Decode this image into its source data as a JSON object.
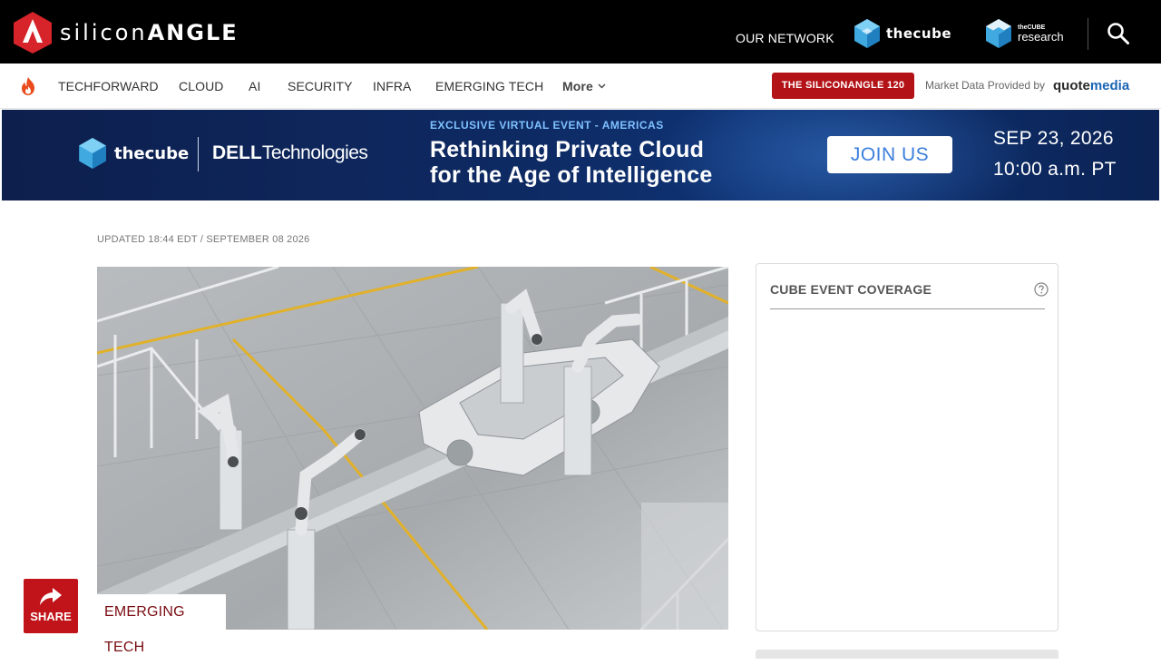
{
  "header": {
    "logo_prefix": "silicon",
    "logo_suffix": "ANGLE",
    "network_label": "OUR NETWORK",
    "cube_label": "thecube",
    "research_small": "theCUBE",
    "research_big": "research"
  },
  "nav": {
    "items": [
      "TECHFORWARD",
      "CLOUD",
      "AI",
      "SECURITY",
      "INFRA",
      "EMERGING TECH"
    ],
    "more_label": "More",
    "sa120_label": "THE SILICONANGLE 120",
    "market_label": "Market Data Provided by",
    "quotemedia_prefix": "quote",
    "quotemedia_suffix": "media"
  },
  "banner": {
    "cube_label": "thecube",
    "dell_bold": "DELL",
    "dell_rest": "Technologies",
    "eyebrow": "EXCLUSIVE VIRTUAL EVENT - AMERICAS",
    "title_line1": "Rethinking Private Cloud",
    "title_line2": "for the Age of Intelligence",
    "cta": "JOIN US",
    "date": "SEP 23, 2026",
    "time": "10:00 a.m. PT"
  },
  "article": {
    "updated": "UPDATED 18:44 EDT / SEPTEMBER 08 2026",
    "category": "EMERGING TECH",
    "share_label": "SHARE"
  },
  "sidebar": {
    "title": "CUBE EVENT COVERAGE"
  },
  "colors": {
    "brand_red": "#c0141a",
    "nav_red": "#b31217",
    "banner_blue": "#0e2a63",
    "quotemedia_blue": "#1a65b4"
  }
}
